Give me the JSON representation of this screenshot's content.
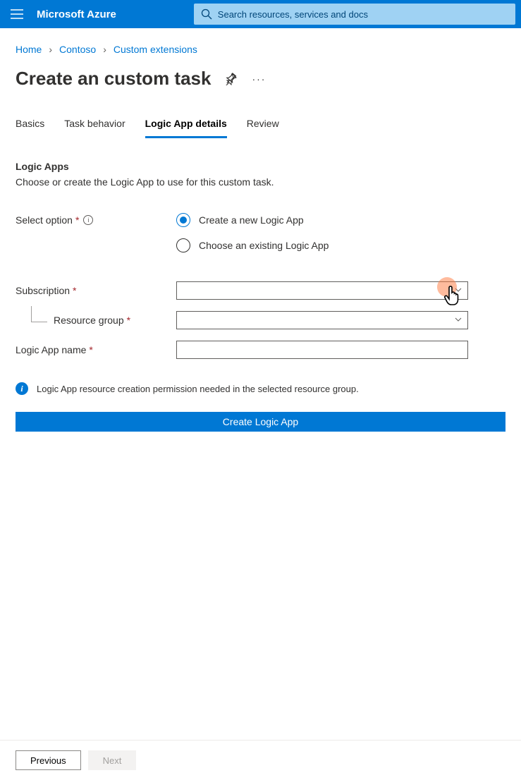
{
  "header": {
    "brand": "Microsoft Azure",
    "search_placeholder": "Search resources, services and docs"
  },
  "breadcrumb": {
    "items": [
      "Home",
      "Contoso",
      "Custom extensions"
    ]
  },
  "page": {
    "title": "Create an custom task"
  },
  "tabs": {
    "items": [
      "Basics",
      "Task behavior",
      "Logic App details",
      "Review"
    ],
    "active_index": 2
  },
  "section": {
    "title": "Logic Apps",
    "description": "Choose or create the Logic App to use for this custom task."
  },
  "form": {
    "select_option_label": "Select option",
    "radio_new": "Create a new Logic App",
    "radio_existing": "Choose an existing Logic App",
    "selected_radio": "new",
    "subscription_label": "Subscription",
    "subscription_value": "",
    "resource_group_label": "Resource group",
    "resource_group_value": "",
    "logic_app_name_label": "Logic App name",
    "logic_app_name_value": ""
  },
  "info": {
    "message": "Logic App resource creation permission needed in the selected resource group."
  },
  "actions": {
    "create_logic_app": "Create Logic App"
  },
  "footer": {
    "previous": "Previous",
    "next": "Next"
  }
}
